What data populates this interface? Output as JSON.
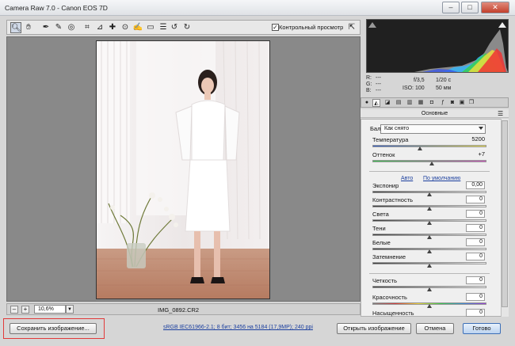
{
  "window": {
    "title": "Camera Raw 7.0  -  Canon EOS 7D",
    "minimize": "–",
    "maximize": "□",
    "close": "✕"
  },
  "toolbar": {
    "tools": [
      "zoom-tool",
      "hand-tool",
      "white-balance-tool",
      "color-sampler-tool",
      "targeted-adjustment-tool",
      "crop-tool",
      "straighten-tool",
      "spot-removal-tool",
      "red-eye-tool",
      "adjustment-brush-tool",
      "graduated-filter-tool",
      "presets-tool",
      "rotate-ccw-tool",
      "rotate-cw-tool"
    ],
    "preview_label": "Контрольный просмотр",
    "preview_checked": "✓"
  },
  "status": {
    "zoom_out": "–",
    "zoom_in": "+",
    "zoom": "10,6%",
    "filename": "IMG_0892.CR2"
  },
  "info": {
    "r_label": "R:",
    "g_label": "G:",
    "b_label": "B:",
    "r": "---",
    "g": "---",
    "b": "---",
    "aperture": "f/3,5",
    "shutter": "1/20 с",
    "iso": "ISO: 100",
    "focal": "50 мм"
  },
  "panel": {
    "title": "Основные",
    "wb_label": "Баланс белого:",
    "wb_value": "Как снято",
    "auto": "Авто",
    "default": "По умолчанию",
    "sliders": [
      {
        "label": "Температура",
        "value": "5200",
        "pos": 0.42,
        "track": "temp"
      },
      {
        "label": "Оттенок",
        "value": "+7",
        "pos": 0.52,
        "track": "tint"
      },
      {
        "label": "Экспонир",
        "value": "0,00",
        "pos": 0.5,
        "track": "gray"
      },
      {
        "label": "Контрастность",
        "value": "0",
        "pos": 0.5,
        "track": "gray"
      },
      {
        "label": "Света",
        "value": "0",
        "pos": 0.5,
        "track": "gray"
      },
      {
        "label": "Тени",
        "value": "0",
        "pos": 0.5,
        "track": "gray"
      },
      {
        "label": "Белые",
        "value": "0",
        "pos": 0.5,
        "track": "gray"
      },
      {
        "label": "Затемнение",
        "value": "0",
        "pos": 0.5,
        "track": "gray"
      },
      {
        "label": "Четкость",
        "value": "0",
        "pos": 0.5,
        "track": "gray"
      },
      {
        "label": "Красочность",
        "value": "0",
        "pos": 0.5,
        "track": "sat"
      },
      {
        "label": "Насыщенность",
        "value": "0",
        "pos": 0.5,
        "track": "sat"
      }
    ]
  },
  "bottom": {
    "save": "Сохранить изображение...",
    "workflow": "sRGB IEC61966-2.1; 8 бит; 3456 на 5184 (17,9МР); 240 ppi",
    "open": "Открыть изображение",
    "cancel": "Отмена",
    "done": "Готово"
  },
  "colors": {
    "accent": "#1b3f9e",
    "highlight_box": "#e13a3a"
  }
}
